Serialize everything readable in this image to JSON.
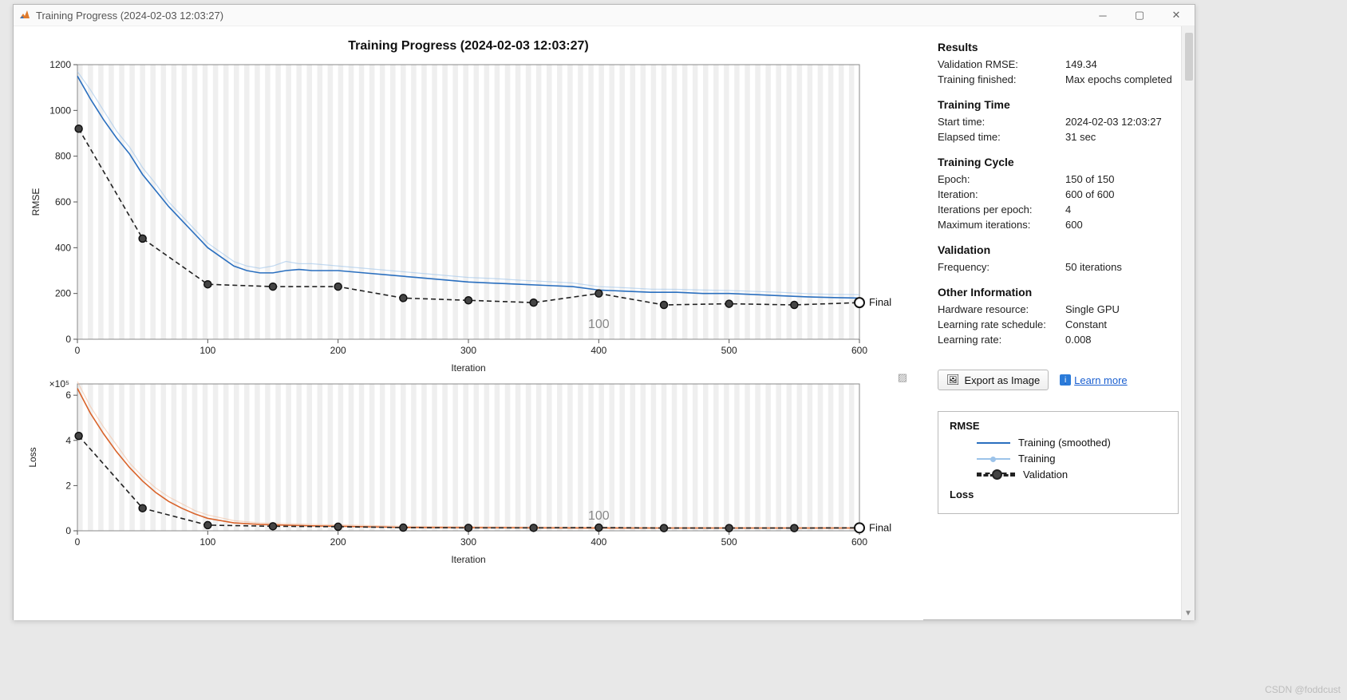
{
  "window": {
    "title": "Training Progress (2024-02-03 12:03:27)"
  },
  "chart_title": "Training Progress (2024-02-03 12:03:27)",
  "final_label": "Final",
  "epoch_marker": "100",
  "watermark": "CSDN @foddcust",
  "results": {
    "heading": "Results",
    "validation_rmse_k": "Validation RMSE:",
    "validation_rmse_v": "149.34",
    "training_finished_k": "Training finished:",
    "training_finished_v": "Max epochs completed"
  },
  "training_time": {
    "heading": "Training Time",
    "start_k": "Start time:",
    "start_v": "2024-02-03 12:03:27",
    "elapsed_k": "Elapsed time:",
    "elapsed_v": "31 sec"
  },
  "training_cycle": {
    "heading": "Training Cycle",
    "epoch_k": "Epoch:",
    "epoch_v": "150 of 150",
    "iter_k": "Iteration:",
    "iter_v": "600 of 600",
    "ipe_k": "Iterations per epoch:",
    "ipe_v": "4",
    "maxit_k": "Maximum iterations:",
    "maxit_v": "600"
  },
  "validation": {
    "heading": "Validation",
    "freq_k": "Frequency:",
    "freq_v": "50 iterations"
  },
  "other": {
    "heading": "Other Information",
    "hw_k": "Hardware resource:",
    "hw_v": "Single GPU",
    "lrs_k": "Learning rate schedule:",
    "lrs_v": "Constant",
    "lr_k": "Learning rate:",
    "lr_v": "0.008"
  },
  "buttons": {
    "export": "Export as Image",
    "learn": "Learn more"
  },
  "legend": {
    "rmse_h": "RMSE",
    "rmse_smoothed": "Training (smoothed)",
    "rmse_training": "Training",
    "rmse_validation": "Validation",
    "loss_h": "Loss"
  },
  "chart_data": [
    {
      "type": "line",
      "title": "RMSE",
      "xlabel": "Iteration",
      "ylabel": "RMSE",
      "xlim": [
        0,
        600
      ],
      "ylim": [
        0,
        1200
      ],
      "xticks": [
        0,
        100,
        200,
        300,
        400,
        500,
        600
      ],
      "yticks": [
        0,
        200,
        400,
        600,
        800,
        1000,
        1200
      ],
      "epoch_marker": {
        "x": 400,
        "label": "100"
      },
      "series": [
        {
          "name": "Training (smoothed)",
          "color": "#2a6fbf",
          "x": [
            0,
            10,
            20,
            30,
            40,
            50,
            60,
            70,
            80,
            90,
            100,
            110,
            120,
            130,
            140,
            150,
            160,
            170,
            180,
            200,
            220,
            240,
            260,
            280,
            300,
            320,
            340,
            360,
            380,
            400,
            420,
            440,
            460,
            480,
            500,
            520,
            540,
            560,
            580,
            600
          ],
          "y": [
            1150,
            1050,
            960,
            880,
            810,
            720,
            650,
            580,
            520,
            460,
            400,
            360,
            320,
            300,
            290,
            290,
            300,
            305,
            300,
            300,
            290,
            280,
            270,
            260,
            250,
            245,
            240,
            235,
            230,
            215,
            210,
            205,
            205,
            200,
            200,
            195,
            190,
            185,
            182,
            180
          ]
        },
        {
          "name": "Training",
          "color": "#9cc3ea",
          "x": [
            0,
            10,
            20,
            30,
            40,
            50,
            60,
            70,
            80,
            90,
            100,
            110,
            120,
            130,
            140,
            150,
            160,
            170,
            180,
            200,
            220,
            240,
            260,
            280,
            300,
            320,
            340,
            360,
            380,
            400,
            420,
            440,
            460,
            480,
            500,
            520,
            540,
            560,
            580,
            600
          ],
          "y": [
            1170,
            1090,
            1000,
            910,
            840,
            750,
            680,
            600,
            540,
            480,
            420,
            380,
            340,
            320,
            310,
            320,
            340,
            330,
            330,
            320,
            310,
            300,
            290,
            280,
            270,
            265,
            258,
            252,
            246,
            230,
            225,
            219,
            218,
            215,
            213,
            209,
            205,
            199,
            196,
            195
          ]
        },
        {
          "name": "Validation",
          "color": "#222",
          "style": "dashed",
          "markers": true,
          "x": [
            1,
            50,
            100,
            150,
            200,
            250,
            300,
            350,
            400,
            450,
            500,
            550,
            600
          ],
          "y": [
            920,
            440,
            240,
            230,
            230,
            180,
            170,
            160,
            200,
            150,
            155,
            150,
            160
          ]
        }
      ]
    },
    {
      "type": "line",
      "title": "Loss",
      "xlabel": "Iteration",
      "ylabel": "Loss",
      "yscale": "×10^5",
      "xlim": [
        0,
        600
      ],
      "ylim": [
        0,
        6.5
      ],
      "xticks": [
        0,
        100,
        200,
        300,
        400,
        500,
        600
      ],
      "yticks": [
        0,
        2,
        4,
        6
      ],
      "epoch_marker": {
        "x": 400,
        "label": "100"
      },
      "series": [
        {
          "name": "Training (smoothed)",
          "color": "#d9632a",
          "x": [
            0,
            10,
            20,
            30,
            40,
            50,
            60,
            70,
            80,
            90,
            100,
            120,
            140,
            160,
            180,
            200,
            250,
            300,
            350,
            400,
            450,
            500,
            550,
            600
          ],
          "y": [
            6.3,
            5.2,
            4.3,
            3.5,
            2.8,
            2.2,
            1.7,
            1.3,
            1.0,
            0.75,
            0.55,
            0.35,
            0.28,
            0.25,
            0.22,
            0.2,
            0.15,
            0.14,
            0.13,
            0.12,
            0.12,
            0.12,
            0.12,
            0.12
          ]
        },
        {
          "name": "Training",
          "color": "#f2bfa2",
          "x": [
            0,
            10,
            20,
            30,
            40,
            50,
            60,
            70,
            80,
            90,
            100,
            120,
            140,
            160,
            180,
            200,
            250,
            300,
            350,
            400,
            450,
            500,
            550,
            600
          ],
          "y": [
            6.6,
            5.5,
            4.6,
            3.8,
            3.0,
            2.4,
            1.9,
            1.5,
            1.2,
            0.9,
            0.7,
            0.45,
            0.35,
            0.32,
            0.28,
            0.26,
            0.2,
            0.18,
            0.17,
            0.16,
            0.15,
            0.15,
            0.15,
            0.15
          ]
        },
        {
          "name": "Validation",
          "color": "#222",
          "style": "dashed",
          "markers": true,
          "x": [
            1,
            50,
            100,
            150,
            200,
            250,
            300,
            350,
            400,
            450,
            500,
            550,
            600
          ],
          "y": [
            4.2,
            1.0,
            0.25,
            0.2,
            0.18,
            0.14,
            0.13,
            0.13,
            0.14,
            0.12,
            0.12,
            0.12,
            0.13
          ]
        }
      ]
    }
  ]
}
